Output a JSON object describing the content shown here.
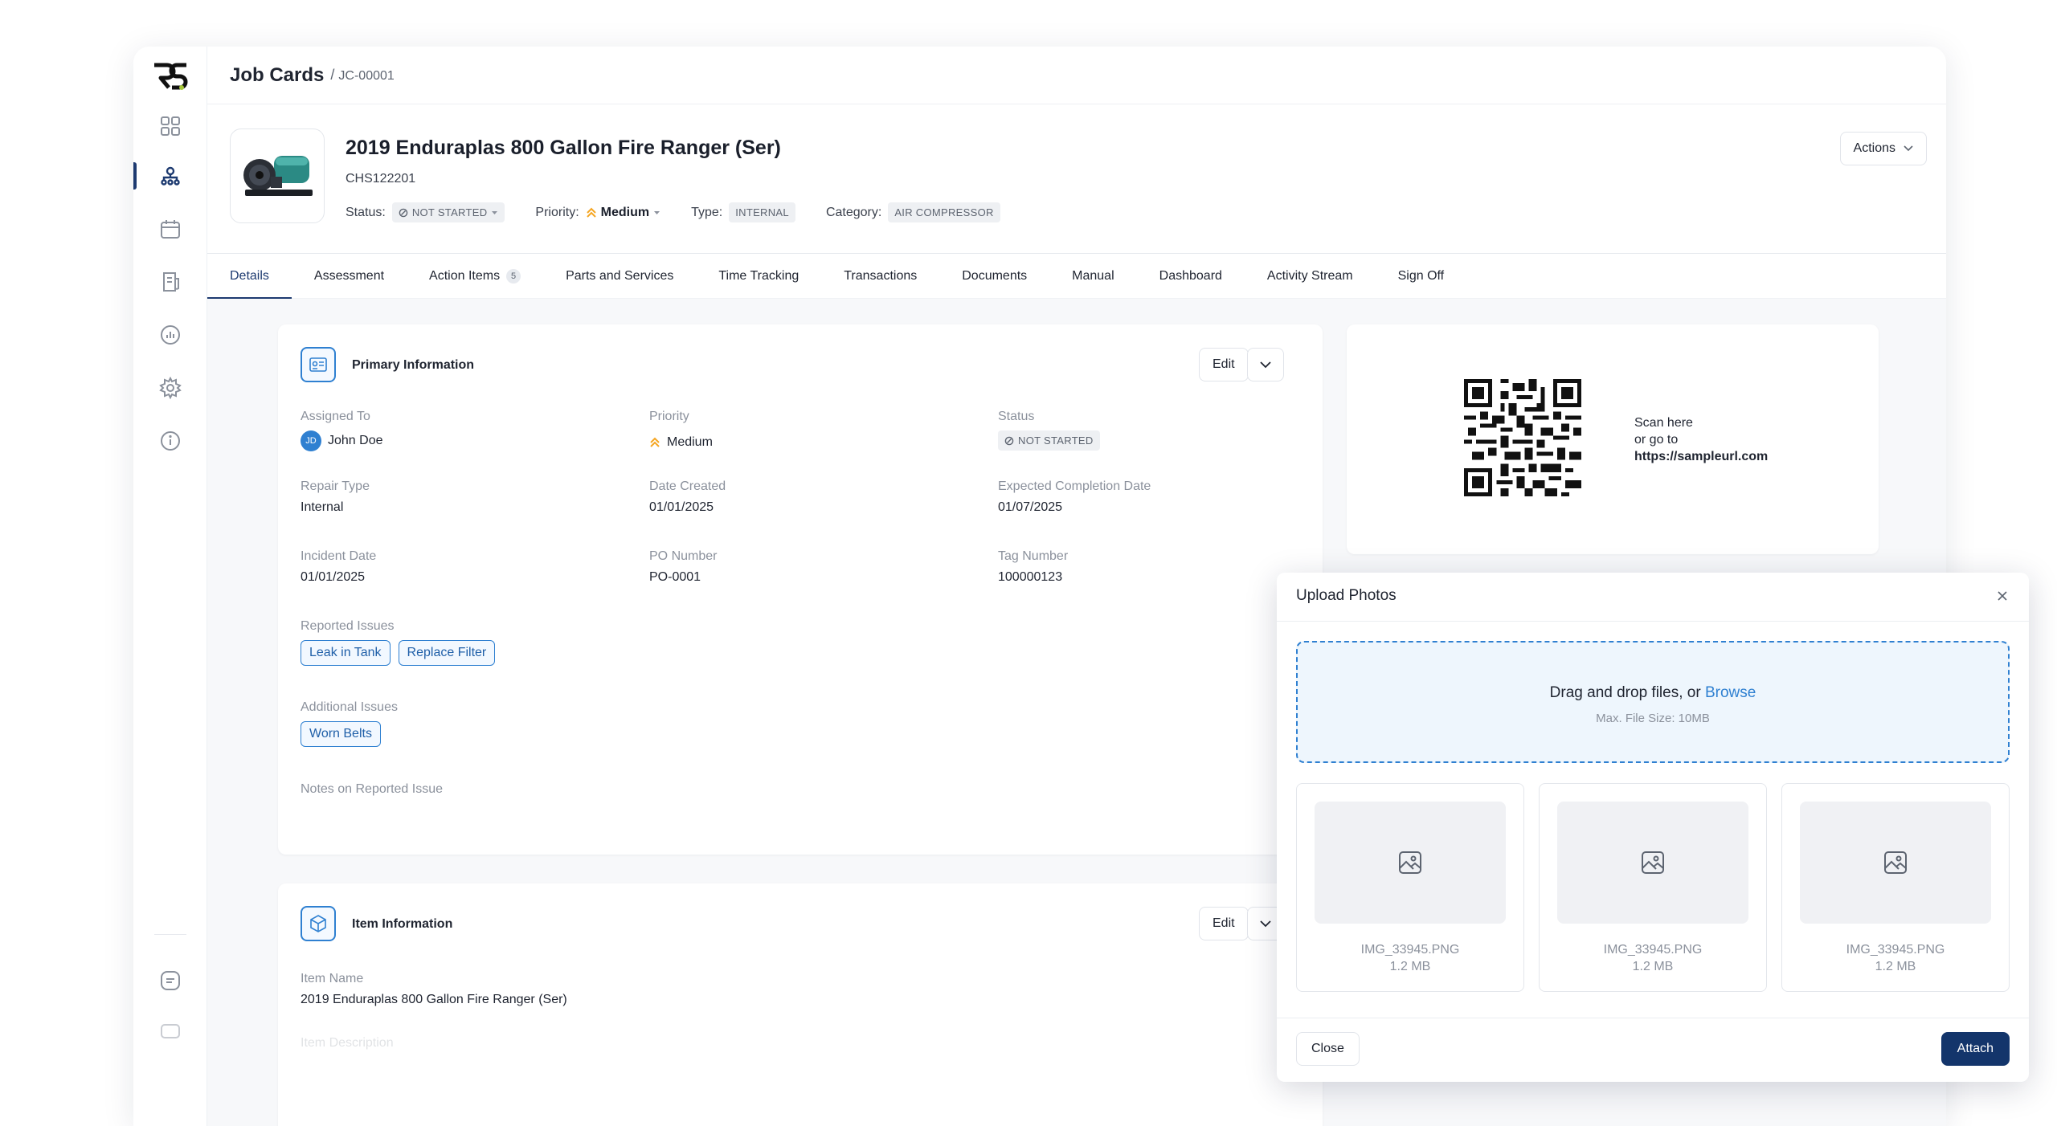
{
  "breadcrumb": {
    "section": "Job Cards",
    "separator": "/",
    "current": "JC-00001"
  },
  "header": {
    "title": "2019 Enduraplas 800 Gallon Fire Ranger (Ser)",
    "subtitle": "CHS122201",
    "status_label": "Status:",
    "status_value": "NOT STARTED",
    "priority_label": "Priority:",
    "priority_value": "Medium",
    "type_label": "Type:",
    "type_value": "INTERNAL",
    "category_label": "Category:",
    "category_value": "AIR COMPRESSOR",
    "actions_label": "Actions"
  },
  "tabs": [
    {
      "label": "Details",
      "active": true
    },
    {
      "label": "Assessment"
    },
    {
      "label": "Action Items",
      "count": "5"
    },
    {
      "label": "Parts and Services"
    },
    {
      "label": "Time Tracking"
    },
    {
      "label": "Transactions"
    },
    {
      "label": "Documents"
    },
    {
      "label": "Manual"
    },
    {
      "label": "Dashboard"
    },
    {
      "label": "Activity Stream"
    },
    {
      "label": "Sign Off"
    }
  ],
  "primary": {
    "title": "Primary Information",
    "edit_label": "Edit",
    "assigned_to_label": "Assigned To",
    "assigned_initials": "JD",
    "assigned_to": "John Doe",
    "priority_label": "Priority",
    "priority": "Medium",
    "status_label": "Status",
    "status": "NOT STARTED",
    "repair_type_label": "Repair Type",
    "repair_type": "Internal",
    "date_created_label": "Date Created",
    "date_created": "01/01/2025",
    "expected_completion_label": "Expected Completion Date",
    "expected_completion": "01/07/2025",
    "incident_date_label": "Incident Date",
    "incident_date": "01/01/2025",
    "po_number_label": "PO Number",
    "po_number": "PO-0001",
    "tag_number_label": "Tag Number",
    "tag_number": "100000123",
    "reported_issues_label": "Reported Issues",
    "reported_issues": [
      "Leak in Tank",
      "Replace Filter"
    ],
    "additional_issues_label": "Additional Issues",
    "additional_issues": [
      "Worn Belts"
    ],
    "notes_label": "Notes on Reported Issue"
  },
  "item": {
    "title": "Item Information",
    "edit_label": "Edit",
    "item_name_label": "Item Name",
    "item_name": "2019 Enduraplas 800 Gallon Fire Ranger (Ser)",
    "next_label": "Item Description"
  },
  "qr": {
    "line1": "Scan here",
    "line2": "or go to",
    "url": "https://sampleurl.com"
  },
  "upload": {
    "title": "Upload Photos",
    "drop_text": "Drag and drop files, or",
    "browse": "Browse",
    "max_size": "Max. File Size: 10MB",
    "files": [
      {
        "name": "IMG_33945.PNG",
        "size": "1.2 MB"
      },
      {
        "name": "IMG_33945.PNG",
        "size": "1.2 MB"
      },
      {
        "name": "IMG_33945.PNG",
        "size": "1.2 MB"
      }
    ],
    "close_label": "Close",
    "attach_label": "Attach"
  },
  "colors": {
    "accent": "#2f80d1",
    "primary_dark": "#13356b",
    "priority": "#f5a623"
  }
}
